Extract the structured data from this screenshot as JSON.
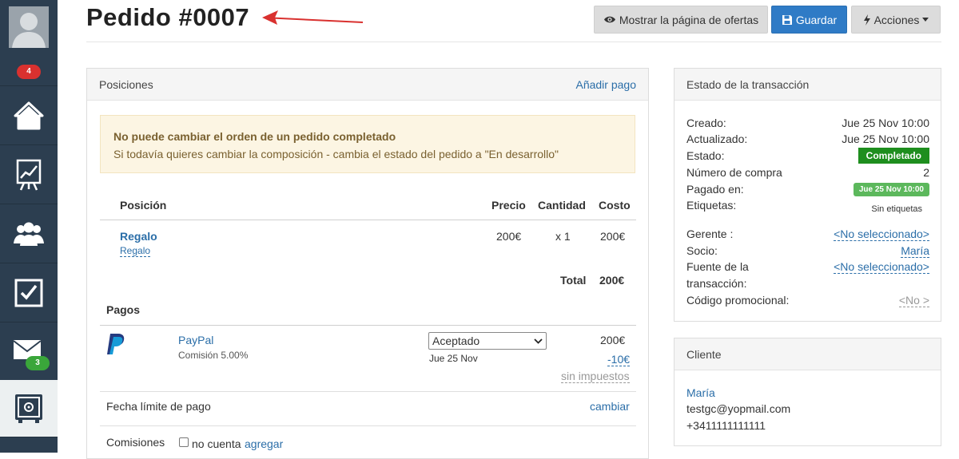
{
  "sidebar": {
    "notifications_count": "4",
    "mail_count": "3",
    "items": [
      {
        "name": "home-icon"
      },
      {
        "name": "chart-board-icon"
      },
      {
        "name": "users-icon"
      },
      {
        "name": "checkbox-icon"
      },
      {
        "name": "mail-icon"
      },
      {
        "name": "safe-icon"
      }
    ]
  },
  "header": {
    "title": "Pedido #0007",
    "buttons": {
      "offers": "Mostrar la página de ofertas",
      "save": "Guardar",
      "actions": "Acciones"
    }
  },
  "positions_panel": {
    "title": "Posiciones",
    "add_payment": "Añadir pago",
    "alert": {
      "title": "No puede cambiar el orden de un pedido completado",
      "text": "Si todavía quieres cambiar la composición - cambia el estado del pedido a \"En desarrollo\""
    },
    "table": {
      "headers": {
        "position": "Posición",
        "price": "Precio",
        "quantity": "Cantidad",
        "cost": "Costo"
      },
      "rows": [
        {
          "name": "Regalo",
          "sub": "Regalo",
          "price": "200€",
          "qty": "x 1",
          "cost": "200€"
        }
      ],
      "total_label": "Total",
      "total_value": "200€"
    },
    "payments": {
      "title": "Pagos",
      "items": [
        {
          "method": "PayPal",
          "commission": "Comisión 5.00%",
          "status": "Aceptado",
          "date": "Jue 25 Nov",
          "amount": "200€",
          "fee": "-10€",
          "tax_note": "sin impuestos"
        }
      ]
    },
    "deadline": {
      "label": "Fecha límite de pago",
      "action": "cambiar"
    },
    "commissions": {
      "label": "Comisiones",
      "checkbox_label": "no cuenta",
      "action": "agregar"
    }
  },
  "transaction_panel": {
    "title": "Estado de la transacción",
    "created_label": "Creado:",
    "created_value": "Jue 25 Nov 10:00",
    "updated_label": "Actualizado:",
    "updated_value": "Jue 25 Nov 10:00",
    "status_label": "Estado:",
    "status_value": "Completado",
    "purchase_label": "Número de compra",
    "purchase_value": "2",
    "paid_label": "Pagado en:",
    "paid_value": "Jue 25 Nov 10:00",
    "tags_label": "Etiquetas:",
    "tags_value": "Sin etiquetas",
    "manager_label": "Gerente :",
    "manager_value": "<No seleccionado>",
    "partner_label": "Socio:",
    "partner_value": "María",
    "source_label_1": "Fuente de la",
    "source_label_2": "transacción:",
    "source_value": "<No seleccionado>",
    "promo_label": "Código promocional:",
    "promo_value": "<No >"
  },
  "client_panel": {
    "title": "Cliente",
    "name": "María",
    "email": "testgc@yopmail.com",
    "phone": "+3411111111111"
  },
  "colors": {
    "accent": "#2f7bc6",
    "sidebar": "#2c3e50",
    "status_done": "#1e8e1e",
    "status_paid": "#5cb85c",
    "alert_bg": "#fcf5e3",
    "annotation_arrow": "#d9312f"
  }
}
